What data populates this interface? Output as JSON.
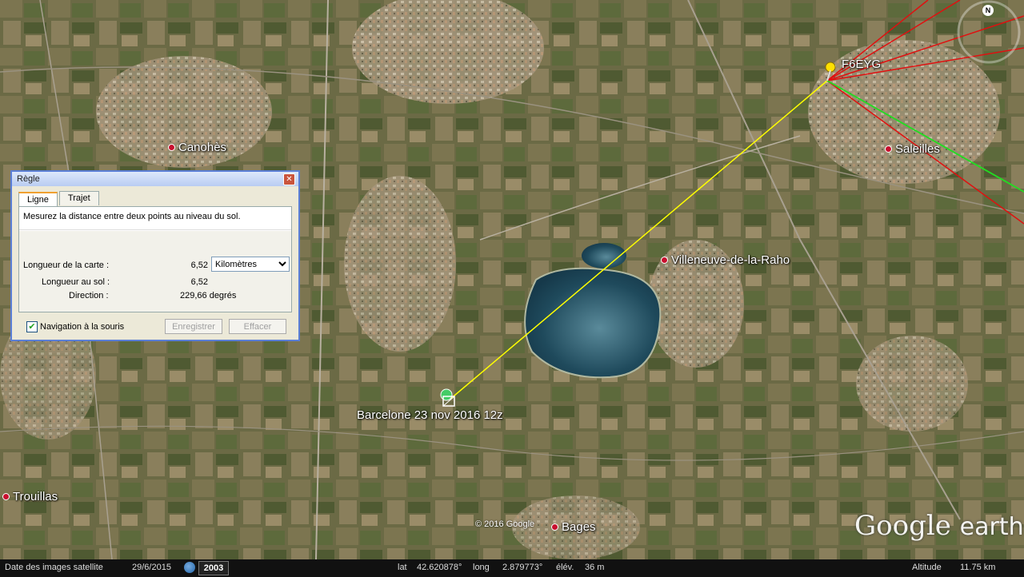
{
  "map": {
    "places": [
      {
        "name": "Canohès"
      },
      {
        "name": "Saleilles"
      },
      {
        "name": "Villeneuve-de-la-Raho"
      },
      {
        "name": "Trouillas"
      },
      {
        "name": "Bages"
      }
    ],
    "placemark_start": "F6EYG",
    "placemark_end": "Barcelone 23 nov 2016 12z",
    "copyright": "© 2016 Google",
    "logo_text": "Google",
    "logo_earth": "earth",
    "north_label": "N"
  },
  "ruler": {
    "title": "Règle",
    "close_label": "✕",
    "tabs": [
      {
        "label": "Ligne"
      },
      {
        "label": "Trajet"
      }
    ],
    "description": "Mesurez la distance entre deux points au niveau du sol.",
    "map_length_label": "Longueur de la carte :",
    "map_length_value": "6,52",
    "unit_selected": "Kilomètres",
    "ground_length_label": "Longueur au sol :",
    "ground_length_value": "6,52",
    "direction_label": "Direction :",
    "direction_value": "229,66 degrés",
    "mouse_nav_label": "Navigation à la souris",
    "mouse_nav_checked": true,
    "save_label": "Enregistrer",
    "clear_label": "Effacer"
  },
  "statusbar": {
    "imagery_label": "Date des images satellite",
    "imagery_date": "29/6/2015",
    "year": "2003",
    "lat_label": "lat",
    "lat_value": "42.620878°",
    "long_label": "long",
    "long_value": "2.879773°",
    "elev_label": "élév.",
    "elev_value": "36 m",
    "altitude_label": "Altitude",
    "altitude_value": "11.75 km"
  },
  "colors": {
    "measure_line": "#ffff00",
    "red_lines": "#e01010",
    "green_line": "#22dd22",
    "dialog_border": "#5b7fd6"
  }
}
